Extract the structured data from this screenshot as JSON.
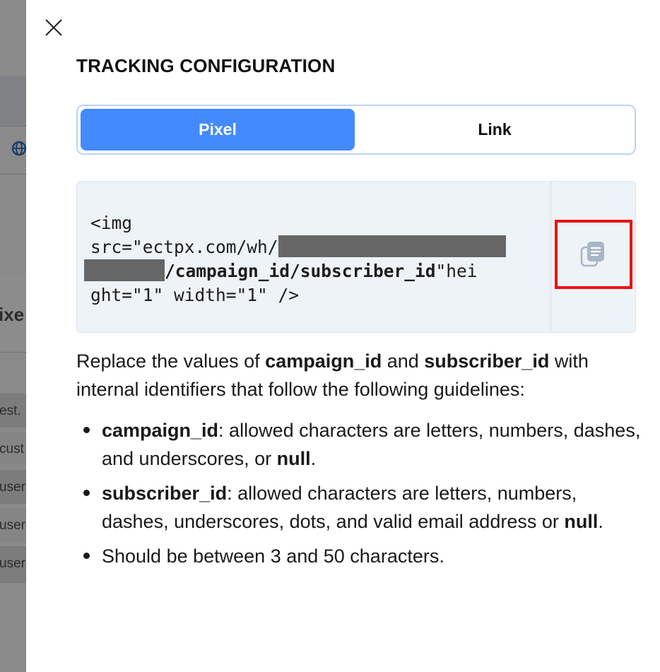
{
  "background": {
    "partial_texts": [
      "ixe",
      "est.",
      "cust",
      "user",
      "user",
      "user"
    ]
  },
  "drawer": {
    "close_icon": "close-icon",
    "title": "TRACKING CONFIGURATION",
    "tabs": [
      {
        "label": "Pixel",
        "active": true
      },
      {
        "label": "Link",
        "active": false
      }
    ],
    "code": {
      "line1": "<img",
      "line2_prefix": "src=\"ectpx.com/wh/",
      "line3_path": "/campaign_id/subscriber_id",
      "line3_suffix": "\"hei",
      "line4": "ght=\"1\" width=\"1\" />",
      "copy_icon": "copy-icon"
    },
    "description": {
      "part1": "Replace the values of ",
      "bold1": "campaign_id",
      "part2": " and ",
      "bold2": "subscriber_id",
      "part3": " with internal identifiers that follow the following guidelines:"
    },
    "guidelines": [
      {
        "bold": "campaign_id",
        "text": ": allowed characters are letters, numbers, dashes, and underscores, or ",
        "bold_end": "null",
        "end": "."
      },
      {
        "bold": "subscriber_id",
        "text": ": allowed characters are letters, numbers, dashes, underscores, dots, and valid email address or ",
        "bold_end": "null",
        "end": "."
      },
      {
        "text": "Should be between 3 and 50 characters."
      }
    ],
    "colors": {
      "accent": "#448aff",
      "tab_border": "#bcd3f5",
      "code_bg": "#eef3f7",
      "highlight": "#ee1111"
    }
  }
}
